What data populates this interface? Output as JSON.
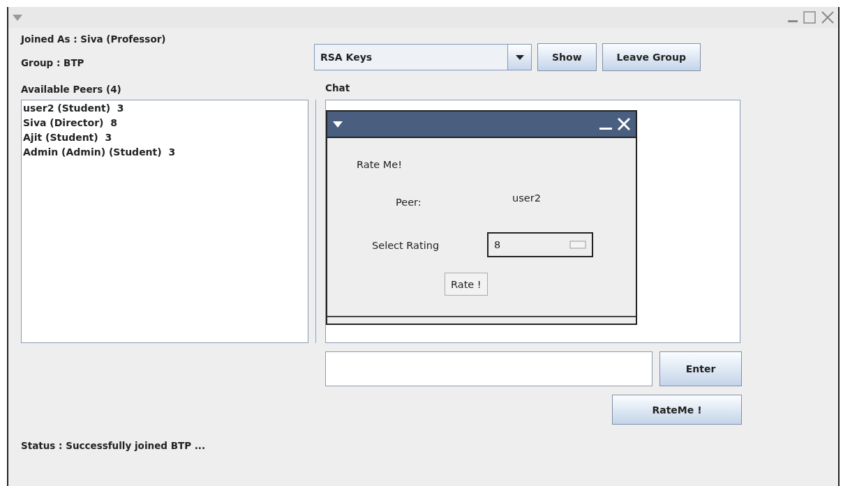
{
  "info": {
    "joined_as": "Joined As : Siva (Professor)",
    "group": "Group : BTP"
  },
  "toolbar": {
    "key_dropdown": "RSA Keys",
    "buttons": [
      "Show",
      "Leave Group"
    ]
  },
  "peers": {
    "label": "Available Peers (4)",
    "items": [
      {
        "text": "user2 (Student)  3"
      },
      {
        "text": "Siva (Director)  8"
      },
      {
        "text": "Ajit (Student)  3"
      },
      {
        "text": "Admin (Admin) (Student)  3"
      }
    ]
  },
  "chat": {
    "label": "Chat",
    "send_button": "Enter",
    "rate_button": "RateMe !"
  },
  "status": "Status : Successfully joined BTP ...",
  "dialog": {
    "heading": "Rate Me!",
    "peer_label": "Peer:",
    "peer_value": "user2",
    "rating_label": "Select Rating",
    "rating_value": "8",
    "button": "Rate !"
  }
}
